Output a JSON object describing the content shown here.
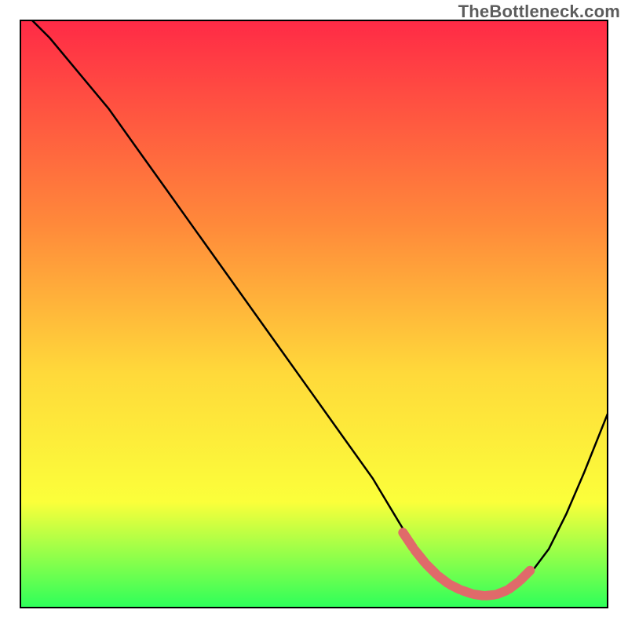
{
  "watermark": "TheBottleneck.com",
  "chart_data": {
    "type": "line",
    "title": "",
    "xlabel": "",
    "ylabel": "",
    "xlim": [
      0,
      100
    ],
    "ylim": [
      0,
      100
    ],
    "series": [
      {
        "name": "bottleneck-curve",
        "x": [
          2,
          5,
          10,
          15,
          20,
          25,
          30,
          35,
          40,
          45,
          50,
          55,
          60,
          63,
          66,
          69,
          72,
          75,
          78,
          81,
          84,
          87,
          90,
          93,
          96,
          100
        ],
        "y": [
          100,
          97,
          91,
          85,
          78,
          71,
          64,
          57,
          50,
          43,
          36,
          29,
          22,
          17,
          12,
          8,
          5,
          3,
          2,
          2,
          3,
          6,
          10,
          16,
          23,
          33
        ]
      }
    ],
    "highlight_segment": {
      "name": "sweet-spot-band",
      "x": [
        65,
        67,
        69,
        71,
        73,
        75,
        77,
        79,
        81,
        83,
        85,
        87
      ],
      "y": [
        13,
        10,
        7.5,
        5.5,
        4,
        3,
        2.3,
        2,
        2.2,
        3,
        4.5,
        6.5
      ]
    },
    "colors": {
      "gradient_top": "#ff2a46",
      "gradient_mid1": "#ff8a3a",
      "gradient_mid2": "#ffd93a",
      "gradient_mid3": "#fbff3a",
      "gradient_bottom": "#2dff5a",
      "curve": "#000000",
      "highlight": "#e06a6a",
      "border": "#000000"
    }
  }
}
